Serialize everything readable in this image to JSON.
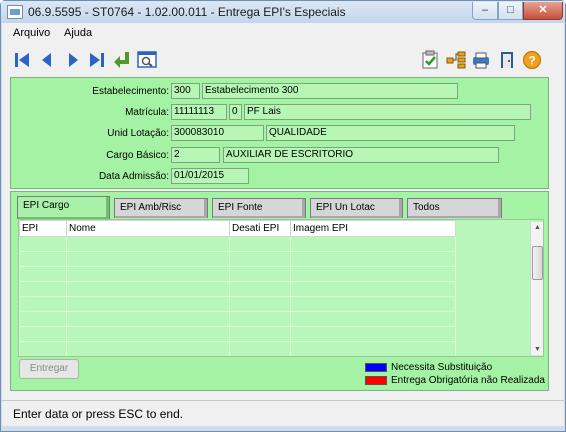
{
  "window": {
    "title": "06.9.5595 - ST0764 - 1.02.00.011 - Entrega EPI's Especiais"
  },
  "menu": [
    {
      "label": "Arquivo"
    },
    {
      "label": "Ajuda"
    }
  ],
  "toolbar": {
    "left": [
      {
        "icon": "first-record-icon"
      },
      {
        "icon": "previous-record-icon"
      },
      {
        "icon": "next-record-icon"
      },
      {
        "icon": "last-record-icon"
      },
      {
        "icon": "enter-return-icon"
      },
      {
        "icon": "preview-icon"
      }
    ],
    "right": [
      {
        "icon": "checklist-icon"
      },
      {
        "icon": "tree-icon"
      },
      {
        "icon": "printer-icon"
      },
      {
        "icon": "exit-door-icon"
      },
      {
        "icon": "help-icon"
      }
    ]
  },
  "form": {
    "estabelecimento": {
      "label": "Estabelecimento:",
      "code": "300",
      "name": "Estabelecimento 300"
    },
    "matricula": {
      "label": "Matrícula:",
      "code": "11111113",
      "digit": "0",
      "name": "PF Lais"
    },
    "unid_lotacao": {
      "label": "Unid Lotação:",
      "code": "300083010",
      "name": "QUALIDADE"
    },
    "cargo_basico": {
      "label": "Cargo Básico:",
      "code": "2",
      "name": "AUXILIAR DE ESCRITORIO"
    },
    "data_admissao": {
      "label": "Data Admissão:",
      "value": "01/01/2015"
    }
  },
  "tabs": [
    {
      "label": "EPI Cargo",
      "active": true
    },
    {
      "label": "EPI  Amb/Risc",
      "active": false
    },
    {
      "label": "EPI Fonte",
      "active": false
    },
    {
      "label": "EPI Un Lotac",
      "active": false
    },
    {
      "label": "Todos",
      "active": false
    }
  ],
  "grid": {
    "columns": [
      "EPI",
      "Nome",
      "Desati EPI",
      "Imagem EPI"
    ],
    "rows": []
  },
  "buttons": {
    "entregar": "Entregar"
  },
  "legend": [
    {
      "color": "#0000ff",
      "label": "Necessita Substituição"
    },
    {
      "color": "#ff0000",
      "label": "Entrega Obrigatória não Realizada"
    }
  ],
  "status": {
    "text": "Enter data or press ESC to end."
  },
  "colors": {
    "pane_green": "#a4f3a4",
    "field_green": "#b6f7b6",
    "window_frame": "#cfdcec"
  }
}
